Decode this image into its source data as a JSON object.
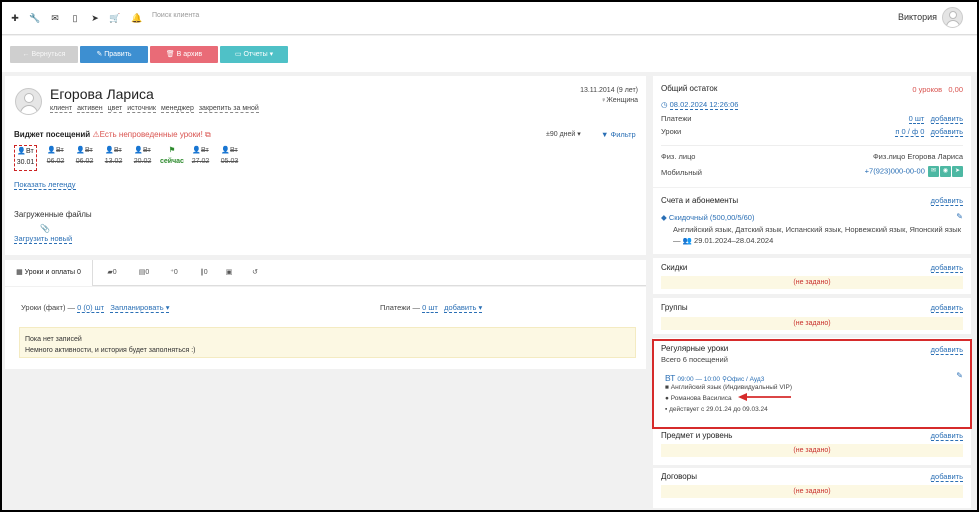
{
  "topbar": {
    "icons": [
      "plus-icon",
      "wrench-icon",
      "envelope-icon",
      "mobile-icon",
      "send-icon",
      "cart-icon",
      "bell-icon"
    ],
    "search_placeholder": "Поиск клиента",
    "user_name": "Виктория"
  },
  "actions": {
    "back": "← Вернуться",
    "edit": "✎ Править",
    "archive": "🗑 В архив",
    "reports": "▭ Отчеты ▾"
  },
  "client": {
    "name": "Егорова Лариса",
    "tags": [
      "клиент",
      "активен",
      "цвет",
      "источник",
      "менеджер",
      "закрепить за мной"
    ],
    "date": "13.11.2014 (9 лет)",
    "gender": "♀Женщина"
  },
  "visits_widget": {
    "title": "Виджет посещений",
    "warning": "Есть непроведенные уроки!",
    "range": "±90 дней ▾",
    "filter": "Фильтр",
    "visits": [
      {
        "day": "Вт",
        "date": "30.01"
      },
      {
        "day": "Вт",
        "date": "06.02"
      },
      {
        "day": "Вт",
        "date": "06.02"
      },
      {
        "day": "Вт",
        "date": "13.02"
      },
      {
        "day": "Вт",
        "date": "20.02"
      },
      {
        "day": "",
        "date": "сейчас"
      },
      {
        "day": "Вт",
        "date": "27.02"
      },
      {
        "day": "Вт",
        "date": "05.03"
      }
    ],
    "legend_link": "Показать легенду"
  },
  "files": {
    "title": "Загруженные файлы",
    "upload_link": "Загрузить новый"
  },
  "tabs": [
    {
      "label": "Уроки и оплаты 0"
    },
    {
      "label": "0"
    },
    {
      "label": "0"
    },
    {
      "label": "0"
    },
    {
      "label": "0"
    },
    {
      "label": ""
    },
    {
      "label": ""
    }
  ],
  "lessons": {
    "fact_label": "Уроки (факт) —",
    "fact_value": "0 (0) шт",
    "plan_link": "Запланировать ▾",
    "payments_label": "Платежи —",
    "payments_value": "0 шт",
    "add_link": "добавить ▾",
    "empty_title": "Пока нет записей",
    "empty_text": "Немного активности, и история будет заполняться :)"
  },
  "balance": {
    "title": "Общий остаток",
    "lessons_value": "0 уроков",
    "money_value": "0,00",
    "date_link": "08.02.2024 12:26:06",
    "payments_label": "Платежи",
    "payments_value": "0 шт",
    "lessons_label": "Уроки",
    "lessons_count": "п 0 / ф 0",
    "add": "добавить",
    "person_label": "Физ. лицо",
    "person_value": "Физ.лицо Егорова Лариса",
    "mobile_label": "Мобильный",
    "mobile_value": "+7(923)000-00-00"
  },
  "accounts": {
    "title": "Счета и абонементы",
    "add": "добавить",
    "discount_name": "Скидочный (500,00/5/60)",
    "discount_desc": "Английский язык, Датский язык, Испанский язык, Норвежский язык, Японский язык —",
    "discount_period": "29.01.2024–28.04.2024"
  },
  "discounts": {
    "title": "Скидки",
    "add": "добавить",
    "value": "(не задано)"
  },
  "groups": {
    "title": "Группы",
    "add": "добавить",
    "value": "(не задано)"
  },
  "regular": {
    "title": "Регулярные уроки",
    "add": "добавить",
    "total": "Всего 6 посещений",
    "day": "ВТ",
    "time": "09:00 — 10:00",
    "place": "Офис / Ауд3",
    "subject": "Английский язык (Индивидуальный VIP)",
    "teacher": "Романова Василиса",
    "valid": "действует с 29.01.24 до 09.03.24"
  },
  "subject_level": {
    "title": "Предмет и уровень",
    "add": "добавить",
    "value": "(не задано)"
  },
  "contracts": {
    "title": "Договоры",
    "add": "добавить",
    "value": "(не задано)"
  },
  "colors": {
    "accent": "#2a6fb5",
    "danger": "#d9534f",
    "success": "#4db8a3",
    "highlight": "#d62b2b"
  }
}
